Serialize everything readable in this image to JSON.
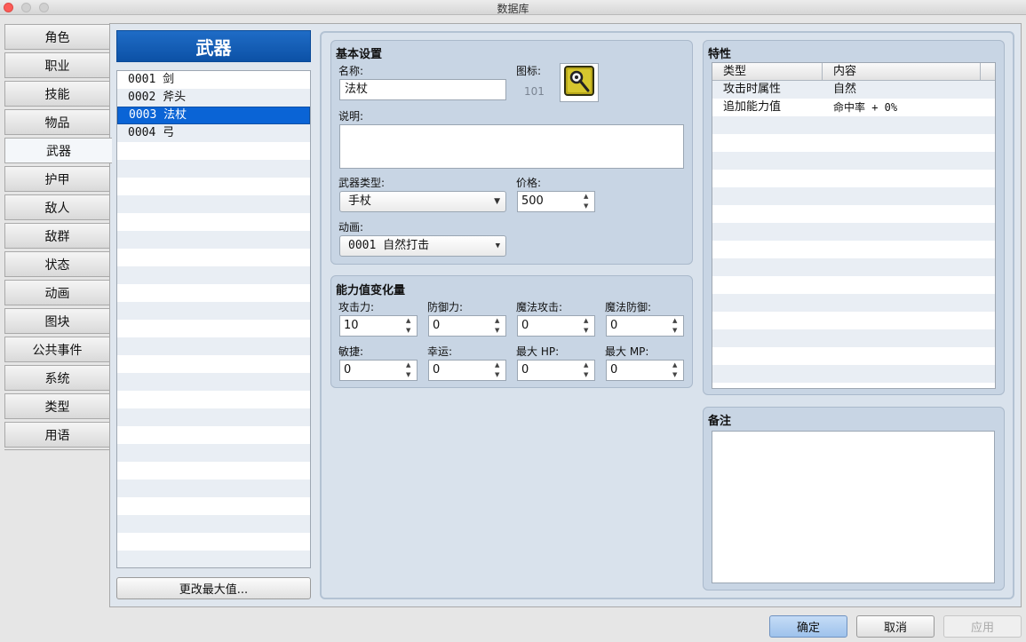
{
  "window": {
    "title": "数据库"
  },
  "sidebar": {
    "tabs": [
      {
        "label": "角色"
      },
      {
        "label": "职业"
      },
      {
        "label": "技能"
      },
      {
        "label": "物品"
      },
      {
        "label": "武器"
      },
      {
        "label": "护甲"
      },
      {
        "label": "敌人"
      },
      {
        "label": "敌群"
      },
      {
        "label": "状态"
      },
      {
        "label": "动画"
      },
      {
        "label": "图块"
      },
      {
        "label": "公共事件"
      },
      {
        "label": "系统"
      },
      {
        "label": "类型"
      },
      {
        "label": "用语"
      }
    ],
    "active_tab": "武器"
  },
  "list": {
    "header": "武器",
    "items": [
      {
        "label": "0001 剑"
      },
      {
        "label": "0002 斧头"
      },
      {
        "label": "0003 法杖"
      },
      {
        "label": "0004 弓"
      }
    ],
    "selected_item": "0003 法杖",
    "change_max_button": "更改最大值..."
  },
  "basic": {
    "title": "基本设置",
    "name_label": "名称:",
    "name_value": "法杖",
    "icon_label": "图标:",
    "icon_index": "101",
    "icon_name": "staff-icon",
    "desc_label": "说明:",
    "desc_value": "",
    "weapon_type_label": "武器类型:",
    "weapon_type_value": "手杖",
    "price_label": "价格:",
    "price_value": "500",
    "animation_label": "动画:",
    "animation_value": "0001 自然打击"
  },
  "params": {
    "title": "能力值变化量",
    "fields": [
      {
        "label": "攻击力:",
        "value": "10"
      },
      {
        "label": "防御力:",
        "value": "0"
      },
      {
        "label": "魔法攻击:",
        "value": "0"
      },
      {
        "label": "魔法防御:",
        "value": "0"
      },
      {
        "label": "敏捷:",
        "value": "0"
      },
      {
        "label": "幸运:",
        "value": "0"
      },
      {
        "label": "最大 HP:",
        "value": "0"
      },
      {
        "label": "最大 MP:",
        "value": "0"
      }
    ]
  },
  "traits": {
    "title": "特性",
    "col_type": "类型",
    "col_content": "内容",
    "rows": [
      {
        "type": "攻击时属性",
        "content": "自然"
      },
      {
        "type": "追加能力值",
        "content": "命中率 + 0%"
      }
    ]
  },
  "notes": {
    "title": "备注",
    "value": ""
  },
  "footer": {
    "ok": "确定",
    "cancel": "取消",
    "apply": "应用"
  },
  "colors": {
    "accent": "#0a64d6",
    "header_blue": "#1660bb",
    "panel_bg": "#c8d5e4"
  }
}
